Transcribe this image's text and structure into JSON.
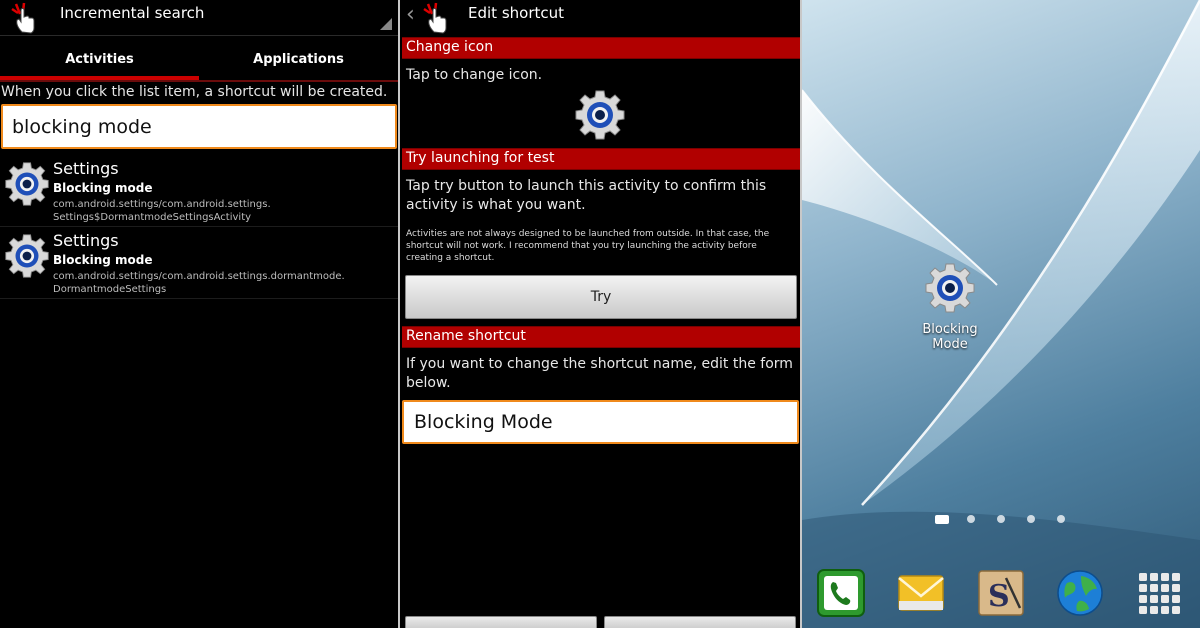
{
  "left_screen": {
    "title": "Incremental search",
    "tabs": [
      {
        "label": "Activities",
        "selected": true
      },
      {
        "label": "Applications",
        "selected": false
      }
    ],
    "hint": "When you click the list item, a shortcut will be created.",
    "search_value": "blocking mode",
    "items": [
      {
        "title": "Settings",
        "subtitle": "Blocking mode",
        "package_line1": "com.android.settings/com.android.settings.",
        "package_line2": "Settings$DormantmodeSettingsActivity"
      },
      {
        "title": "Settings",
        "subtitle": "Blocking mode",
        "package_line1": "com.android.settings/com.android.settings.dormantmode.",
        "package_line2": "DormantmodeSettings"
      }
    ]
  },
  "middle_screen": {
    "title": "Edit shortcut",
    "change_icon": {
      "header": "Change icon",
      "text": "Tap to change icon."
    },
    "try_launch": {
      "header": "Try launching for test",
      "text_line1": "Tap try button to launch this activity to confirm this",
      "text_line2": "activity is what you want.",
      "note_line1": "Activities are not always designed to be launched from outside. In that case, the",
      "note_line2": "shortcut will not work. I recommend that you try launching the activity before",
      "note_line3": "creating a shortcut.",
      "button_label": "Try"
    },
    "rename": {
      "header": "Rename shortcut",
      "text_line1": "If you want to change the shortcut name, edit the form",
      "text_line2": "below.",
      "input_value": "Blocking Mode"
    }
  },
  "home_screen": {
    "shortcut_label_line1": "Blocking",
    "shortcut_label_line2": "Mode",
    "page_count": 5,
    "active_page": 1,
    "dock_icons": [
      "phone-icon",
      "email-icon",
      "s-note-icon",
      "internet-globe-icon",
      "apps-grid-icon"
    ]
  },
  "colors": {
    "section_red": "#b10000",
    "tab_indicator": "#cc0000",
    "input_focus_orange": "#f08a1c",
    "gear_blue": "#1f4fb8"
  }
}
